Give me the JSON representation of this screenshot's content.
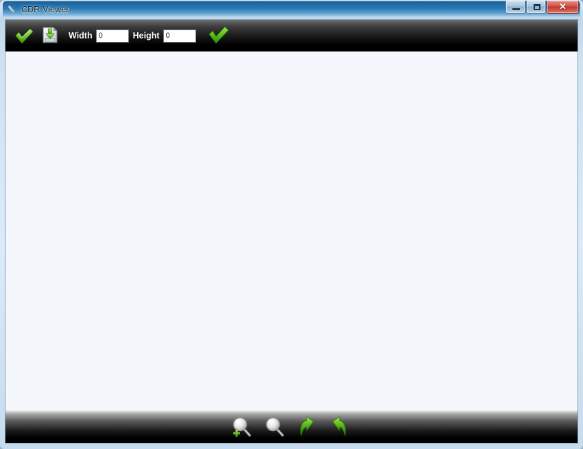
{
  "window": {
    "title": "CDR Viewer",
    "app_icon": "pencil-icon",
    "controls": {
      "minimize_label": "—",
      "maximize_label": "□",
      "close_label": "✕"
    }
  },
  "toolbar_top": {
    "open_button": {
      "name": "open-file-button",
      "icon": "green-check-open-icon",
      "tooltip": "Open"
    },
    "save_button": {
      "name": "save-file-button",
      "icon": "save-disk-icon",
      "tooltip": "Save"
    },
    "width_label": "Width",
    "width_value": "0",
    "width_placeholder": "0",
    "height_label": "Height",
    "height_value": "0",
    "height_placeholder": "0",
    "apply_button": {
      "name": "apply-size-button",
      "icon": "green-check-icon",
      "tooltip": "Apply"
    }
  },
  "viewer": {
    "content": "",
    "background_color": "#f4f7fb"
  },
  "toolbar_bottom": {
    "buttons": [
      {
        "name": "zoom-in-button",
        "icon": "magnifier-plus-icon",
        "tooltip": "Zoom In"
      },
      {
        "name": "zoom-out-button",
        "icon": "magnifier-icon",
        "tooltip": "Zoom Out"
      },
      {
        "name": "rotate-left-button",
        "icon": "arrow-rotate-left-icon",
        "tooltip": "Rotate Left"
      },
      {
        "name": "rotate-right-button",
        "icon": "arrow-rotate-right-icon",
        "tooltip": "Rotate Right"
      }
    ]
  },
  "colors": {
    "titlebar_blue": "#2a7ab4",
    "toolbar_black": "#000000",
    "canvas": "#f4f7fb",
    "accent_green": "#5cc226",
    "close_red": "#c0392c"
  }
}
